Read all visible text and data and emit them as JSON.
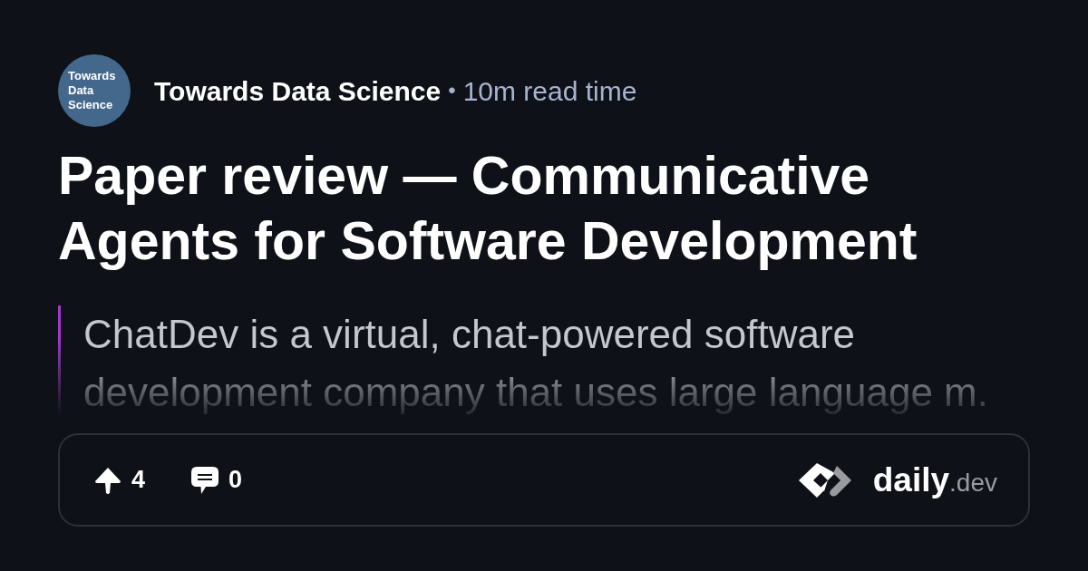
{
  "source": {
    "logo_text": "Towards Data Science",
    "name": "Towards Data Science",
    "separator": "•",
    "read_time": "10m read time"
  },
  "title": "Paper review — Communicative Agents for Software Development",
  "summary": "ChatDev is a virtual, chat-powered software development company that uses large language m.",
  "stats": [
    {
      "kind": "upvotes",
      "count": "4"
    },
    {
      "kind": "comments",
      "count": "0"
    }
  ],
  "brand": {
    "name": "daily",
    "suffix": ".dev"
  }
}
